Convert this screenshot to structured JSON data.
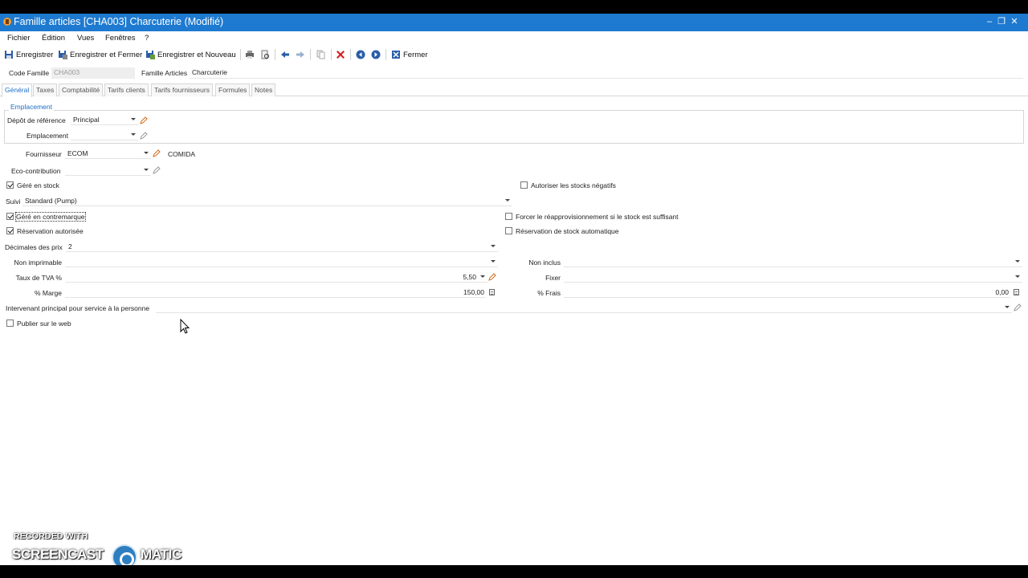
{
  "window": {
    "title": "Famille articles [CHA003] Charcuterie (Modifié)",
    "controls": {
      "minimize": "–",
      "restore": "❐",
      "close": "✕"
    }
  },
  "menubar": {
    "items": [
      "Fichier",
      "Édition",
      "Vues",
      "Fenêtres",
      "?"
    ]
  },
  "toolbar": {
    "save_label": "Enregistrer",
    "save_close_label": "Enregistrer et Fermer",
    "save_new_label": "Enregistrer et Nouveau",
    "close_label": "Fermer"
  },
  "header": {
    "code_famille_label": "Code Famille",
    "code_famille_value": "CHA003",
    "famille_articles_label": "Famille Articles",
    "famille_articles_value": "Charcuterie"
  },
  "tabs": [
    "Général",
    "Taxes",
    "Comptabilité",
    "Tarifs clients",
    "Tarifs fournisseurs",
    "Formules",
    "Notes"
  ],
  "emplacement": {
    "group_title": "Emplacement",
    "depot_label": "Dépôt de référence",
    "depot_value": "Principal",
    "emplacement_label": "Emplacement",
    "emplacement_value": ""
  },
  "fournisseur": {
    "label": "Fournisseur",
    "value": "ECOM",
    "name": "COMIDA"
  },
  "eco": {
    "label": "Eco-contribution",
    "value": ""
  },
  "checks": {
    "gere_stock": {
      "label": "Géré en stock",
      "checked": true
    },
    "stocks_negatifs": {
      "label": "Autoriser les stocks négatifs",
      "checked": false
    },
    "contremarque": {
      "label": "Géré en contremarque",
      "checked": true
    },
    "reappro": {
      "label": "Forcer le réapprovisionnement si le stock est suffisant",
      "checked": false
    },
    "reservation": {
      "label": "Réservation autorisée",
      "checked": true
    },
    "reservation_auto": {
      "label": "Réservation de stock automatique",
      "checked": false
    },
    "publier": {
      "label": "Publier sur le web",
      "checked": false
    }
  },
  "suivi": {
    "label": "Suivi",
    "value": "Standard (Pump)"
  },
  "decimales": {
    "label": "Décimales des prix",
    "value": "2"
  },
  "non_imprimable": {
    "label": "Non imprimable",
    "value": ""
  },
  "non_inclus": {
    "label": "Non inclus",
    "value": ""
  },
  "taux_tva": {
    "label": "Taux de TVA %",
    "value": "5,50"
  },
  "fixer": {
    "label": "Fixer",
    "value": ""
  },
  "marge": {
    "label": "% Marge",
    "value": "150,00"
  },
  "frais": {
    "label": "% Frais",
    "value": "0,00"
  },
  "intervenant": {
    "label": "Intervenant principal pour service à la personne",
    "value": ""
  },
  "watermark": {
    "line1": "RECORDED WITH",
    "line2": "SCREENCAST",
    "line3": "MATIC"
  },
  "colors": {
    "titlebar": "#1e7ad0",
    "accent": "#1e6ec8",
    "delete": "#d42020"
  }
}
